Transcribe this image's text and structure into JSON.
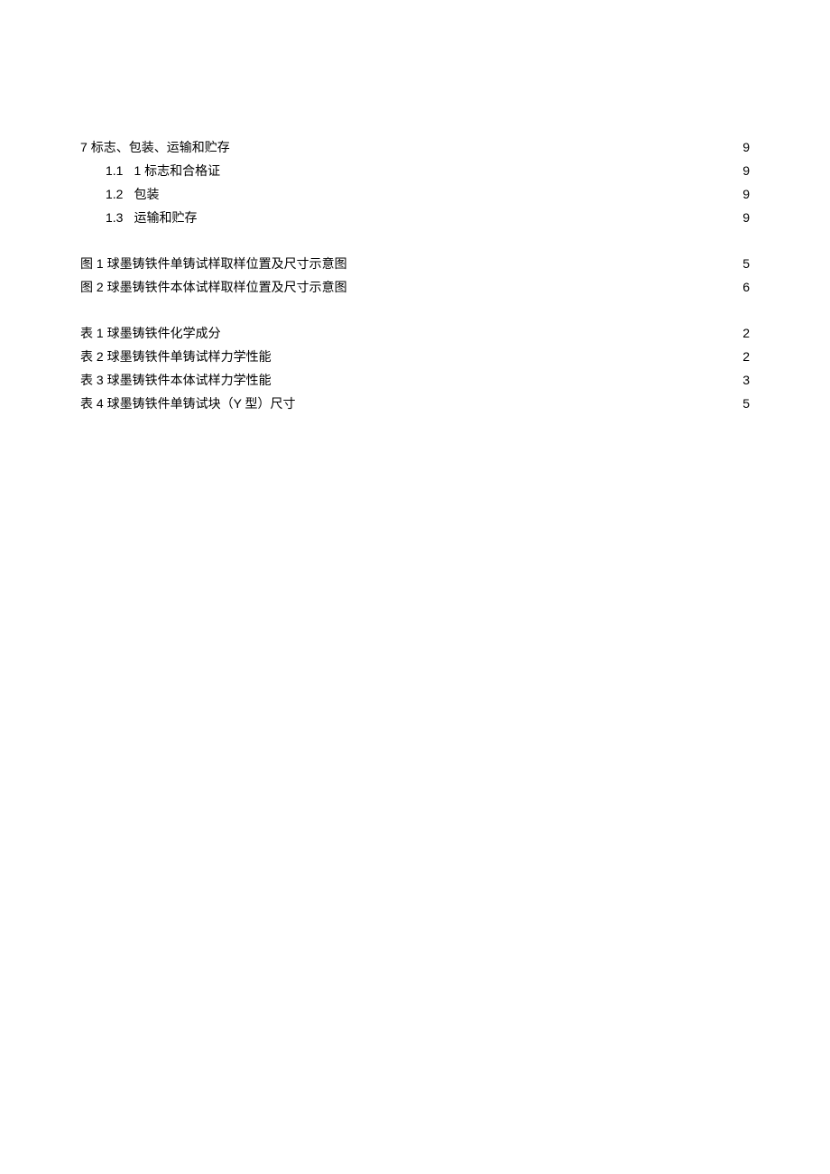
{
  "toc": {
    "section_entries": [
      {
        "num": "7",
        "label": "标志、包装、运输和贮存",
        "page": "9",
        "indent": 0
      },
      {
        "num": "1.1",
        "label": "1 标志和合格证",
        "page": "9",
        "indent": 1
      },
      {
        "num": "1.2",
        "label": "包装",
        "page": "9",
        "indent": 1
      },
      {
        "num": "1.3",
        "label": "运输和贮存",
        "page": "9",
        "indent": 1
      }
    ],
    "figure_entries": [
      {
        "label": "图 1 球墨铸铁件单铸试样取样位置及尺寸示意图",
        "page": "5"
      },
      {
        "label": "图 2 球墨铸铁件本体试样取样位置及尺寸示意图",
        "page": "6"
      }
    ],
    "table_entries": [
      {
        "label": "表 1 球墨铸铁件化学成分",
        "page": "2"
      },
      {
        "label": "表 2 球墨铸铁件单铸试样力学性能",
        "page": "2"
      },
      {
        "label": "表 3 球墨铸铁件本体试样力学性能",
        "page": "3"
      },
      {
        "label": "表 4 球墨铸铁件单铸试块（Y 型）尺寸",
        "page": "5"
      }
    ]
  }
}
